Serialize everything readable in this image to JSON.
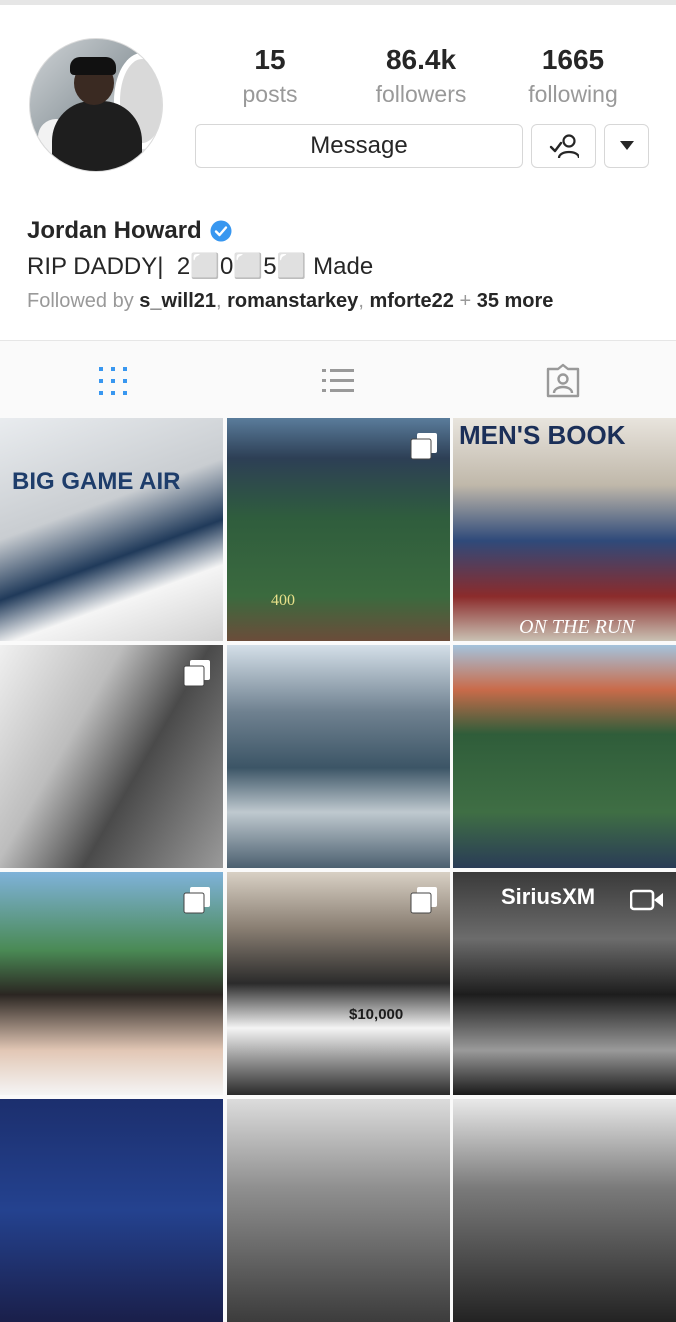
{
  "profile": {
    "name": "Jordan Howard",
    "bio": "RIP DADDY|  2⬜0⬜5⬜ Made",
    "followed_by_prefix": "Followed by ",
    "followed_by_user1": "s_will21",
    "followed_by_user2": "romanstarkey",
    "followed_by_user3": "mforte22",
    "followed_by_more": "35 more"
  },
  "stats": {
    "posts_count": "15",
    "posts_label": "posts",
    "followers_count": "86.4k",
    "followers_label": "followers",
    "following_count": "1665",
    "following_label": "following"
  },
  "actions": {
    "message_label": "Message"
  },
  "tile_text": {
    "big_game_air": "BIG GAME AIR",
    "men_s_book": "MEN'S BOOK",
    "on_the_run": "ON THE RUN",
    "siriusxm": "SiriusXM",
    "check_amount": "$10,000",
    "scoreboard": "400"
  },
  "colors": {
    "verified": "#3897f0",
    "active_tab": "#3897f0",
    "muted_text": "#999999"
  }
}
